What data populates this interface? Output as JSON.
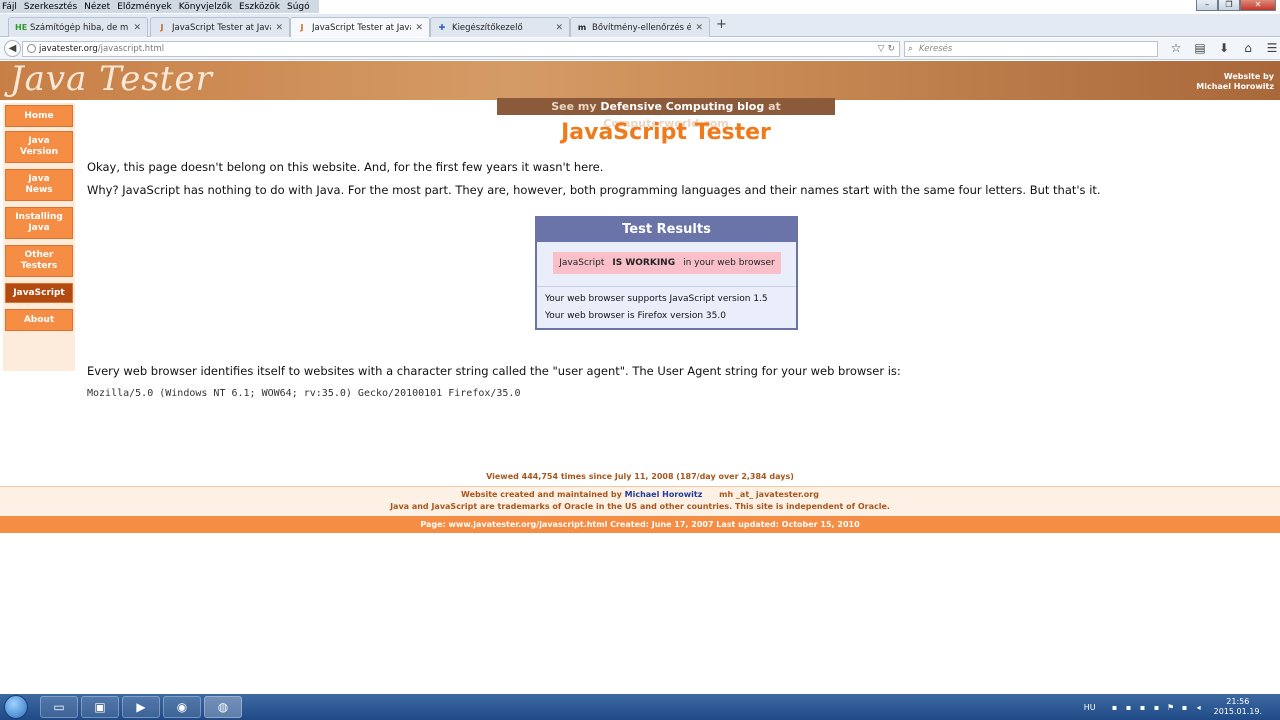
{
  "menubar": {
    "items": [
      "Fájl",
      "Szerkesztés",
      "Nézet",
      "Előzmények",
      "Könyvjelzők",
      "Eszközök",
      "Súgó"
    ]
  },
  "tabs": [
    {
      "favicon": "HE",
      "label": "Számítógép hiba, de mi a p..."
    },
    {
      "favicon": "J",
      "label": "JavaScript Tester at Java Te..."
    },
    {
      "favicon": "J",
      "label": "JavaScript Tester at Java Te..."
    },
    {
      "favicon": "puzzle-icon",
      "label": "Kiegészítőkezelő"
    },
    {
      "favicon": "m",
      "label": "Bővítmény-ellenőrzés és fri..."
    }
  ],
  "navbar": {
    "url_domain": "javatester.org",
    "url_path": "/javascript.html",
    "search_placeholder": "Keresés"
  },
  "banner": {
    "logo": "Java Tester",
    "byline1": "Website by",
    "byline2": "Michael Horowitz"
  },
  "sidebar": {
    "items": [
      {
        "line1": "Home",
        "line2": ""
      },
      {
        "line1": "Java",
        "line2": "Version"
      },
      {
        "line1": "Java",
        "line2": "News"
      },
      {
        "line1": "Installing",
        "line2": "Java"
      },
      {
        "line1": "Other",
        "line2": "Testers"
      },
      {
        "line1": "JavaScript",
        "line2": ""
      },
      {
        "line1": "About",
        "line2": ""
      }
    ],
    "active_index": 5
  },
  "promo": {
    "pre": "See my ",
    "bold": "Defensive Computing blog",
    "post": " at Computerworld.com"
  },
  "main": {
    "title": "JavaScript Tester",
    "para1": "Okay, this page doesn't belong on this website. And, for the first few years it wasn't here.",
    "para2": "Why? JavaScript has nothing to do with Java. For the most part. They are, however, both programming languages and their names start with the same four letters. But that's it.",
    "results_title": "Test Results",
    "working_pre": "JavaScript",
    "working_bold": "IS WORKING",
    "working_post": "in your web browser",
    "support_line": "Your web browser supports JavaScript version 1.5",
    "browser_line": "Your web browser is Firefox version 35.0",
    "ua_para": "Every web browser identifies itself to websites with a character string called the \"user agent\". The User Agent string for your web browser is:",
    "ua_string": "Mozilla/5.0 (Windows NT 6.1; WOW64; rv:35.0) Gecko/20100101 Firefox/35.0"
  },
  "footer": {
    "viewed": "Viewed 444,754 times since July 11, 2008 (187/day over 2,384 days)",
    "created_pre": "Website created and maintained by ",
    "author": "Michael Horowitz",
    "email": "mh _at_ javatester.org",
    "trademark": "Java and JavaScript are trademarks of Oracle in the US and other countries. This site is independent of Oracle.",
    "page_info": "Page: www.javatester.org/javascript.html     Created: June 17, 2007    Last updated: October 15, 2010"
  },
  "taskbar": {
    "apps": [
      "folder-icon",
      "floppy-icon",
      "media-player-icon",
      "chrome-icon",
      "firefox-icon"
    ],
    "lang": "HU",
    "time": "21:56",
    "date": "2015.01.19."
  },
  "colors": {
    "accent_orange": "#f68d45",
    "title_orange": "#f07a1a",
    "results_blue": "#6b74a8",
    "banner_brown": "#c77f46"
  }
}
